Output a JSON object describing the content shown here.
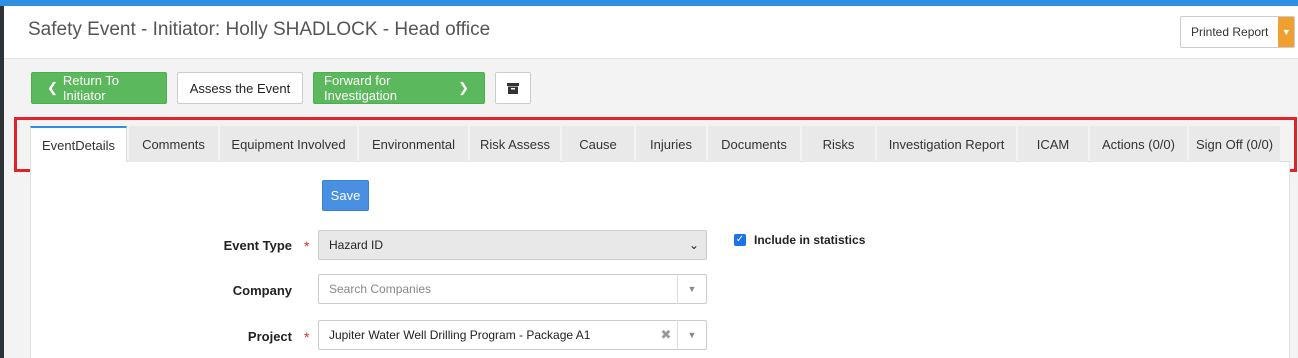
{
  "header": {
    "title": "Safety Event - Initiator: Holly SHADLOCK - Head office",
    "printed_report": "Printed Report"
  },
  "toolbar": {
    "return_label": "Return To Initiator",
    "assess_label": "Assess the Event",
    "forward_label": "Forward for Investigation"
  },
  "tabs": [
    {
      "label": "EventDetails"
    },
    {
      "label": "Comments"
    },
    {
      "label": "Equipment Involved"
    },
    {
      "label": "Environmental"
    },
    {
      "label": "Risk Assess"
    },
    {
      "label": "Cause"
    },
    {
      "label": "Injuries"
    },
    {
      "label": "Documents"
    },
    {
      "label": "Risks"
    },
    {
      "label": "Investigation Report"
    },
    {
      "label": "ICAM"
    },
    {
      "label": "Actions (0/0)"
    },
    {
      "label": "Sign Off (0/0)"
    }
  ],
  "form": {
    "save_label": "Save",
    "event_type": {
      "label": "Event Type",
      "value": "Hazard ID"
    },
    "company": {
      "label": "Company",
      "placeholder": "Search Companies"
    },
    "project": {
      "label": "Project",
      "value": "Jupiter Water Well Drilling Program - Package A1"
    },
    "include_stats": {
      "label": "Include in statistics",
      "checked": true
    }
  },
  "colors": {
    "accent": "#2f8fe0",
    "green": "#5cb85c",
    "save_blue": "#4a90e2",
    "highlight_red": "#e0222a",
    "orange": "#f0a030"
  }
}
